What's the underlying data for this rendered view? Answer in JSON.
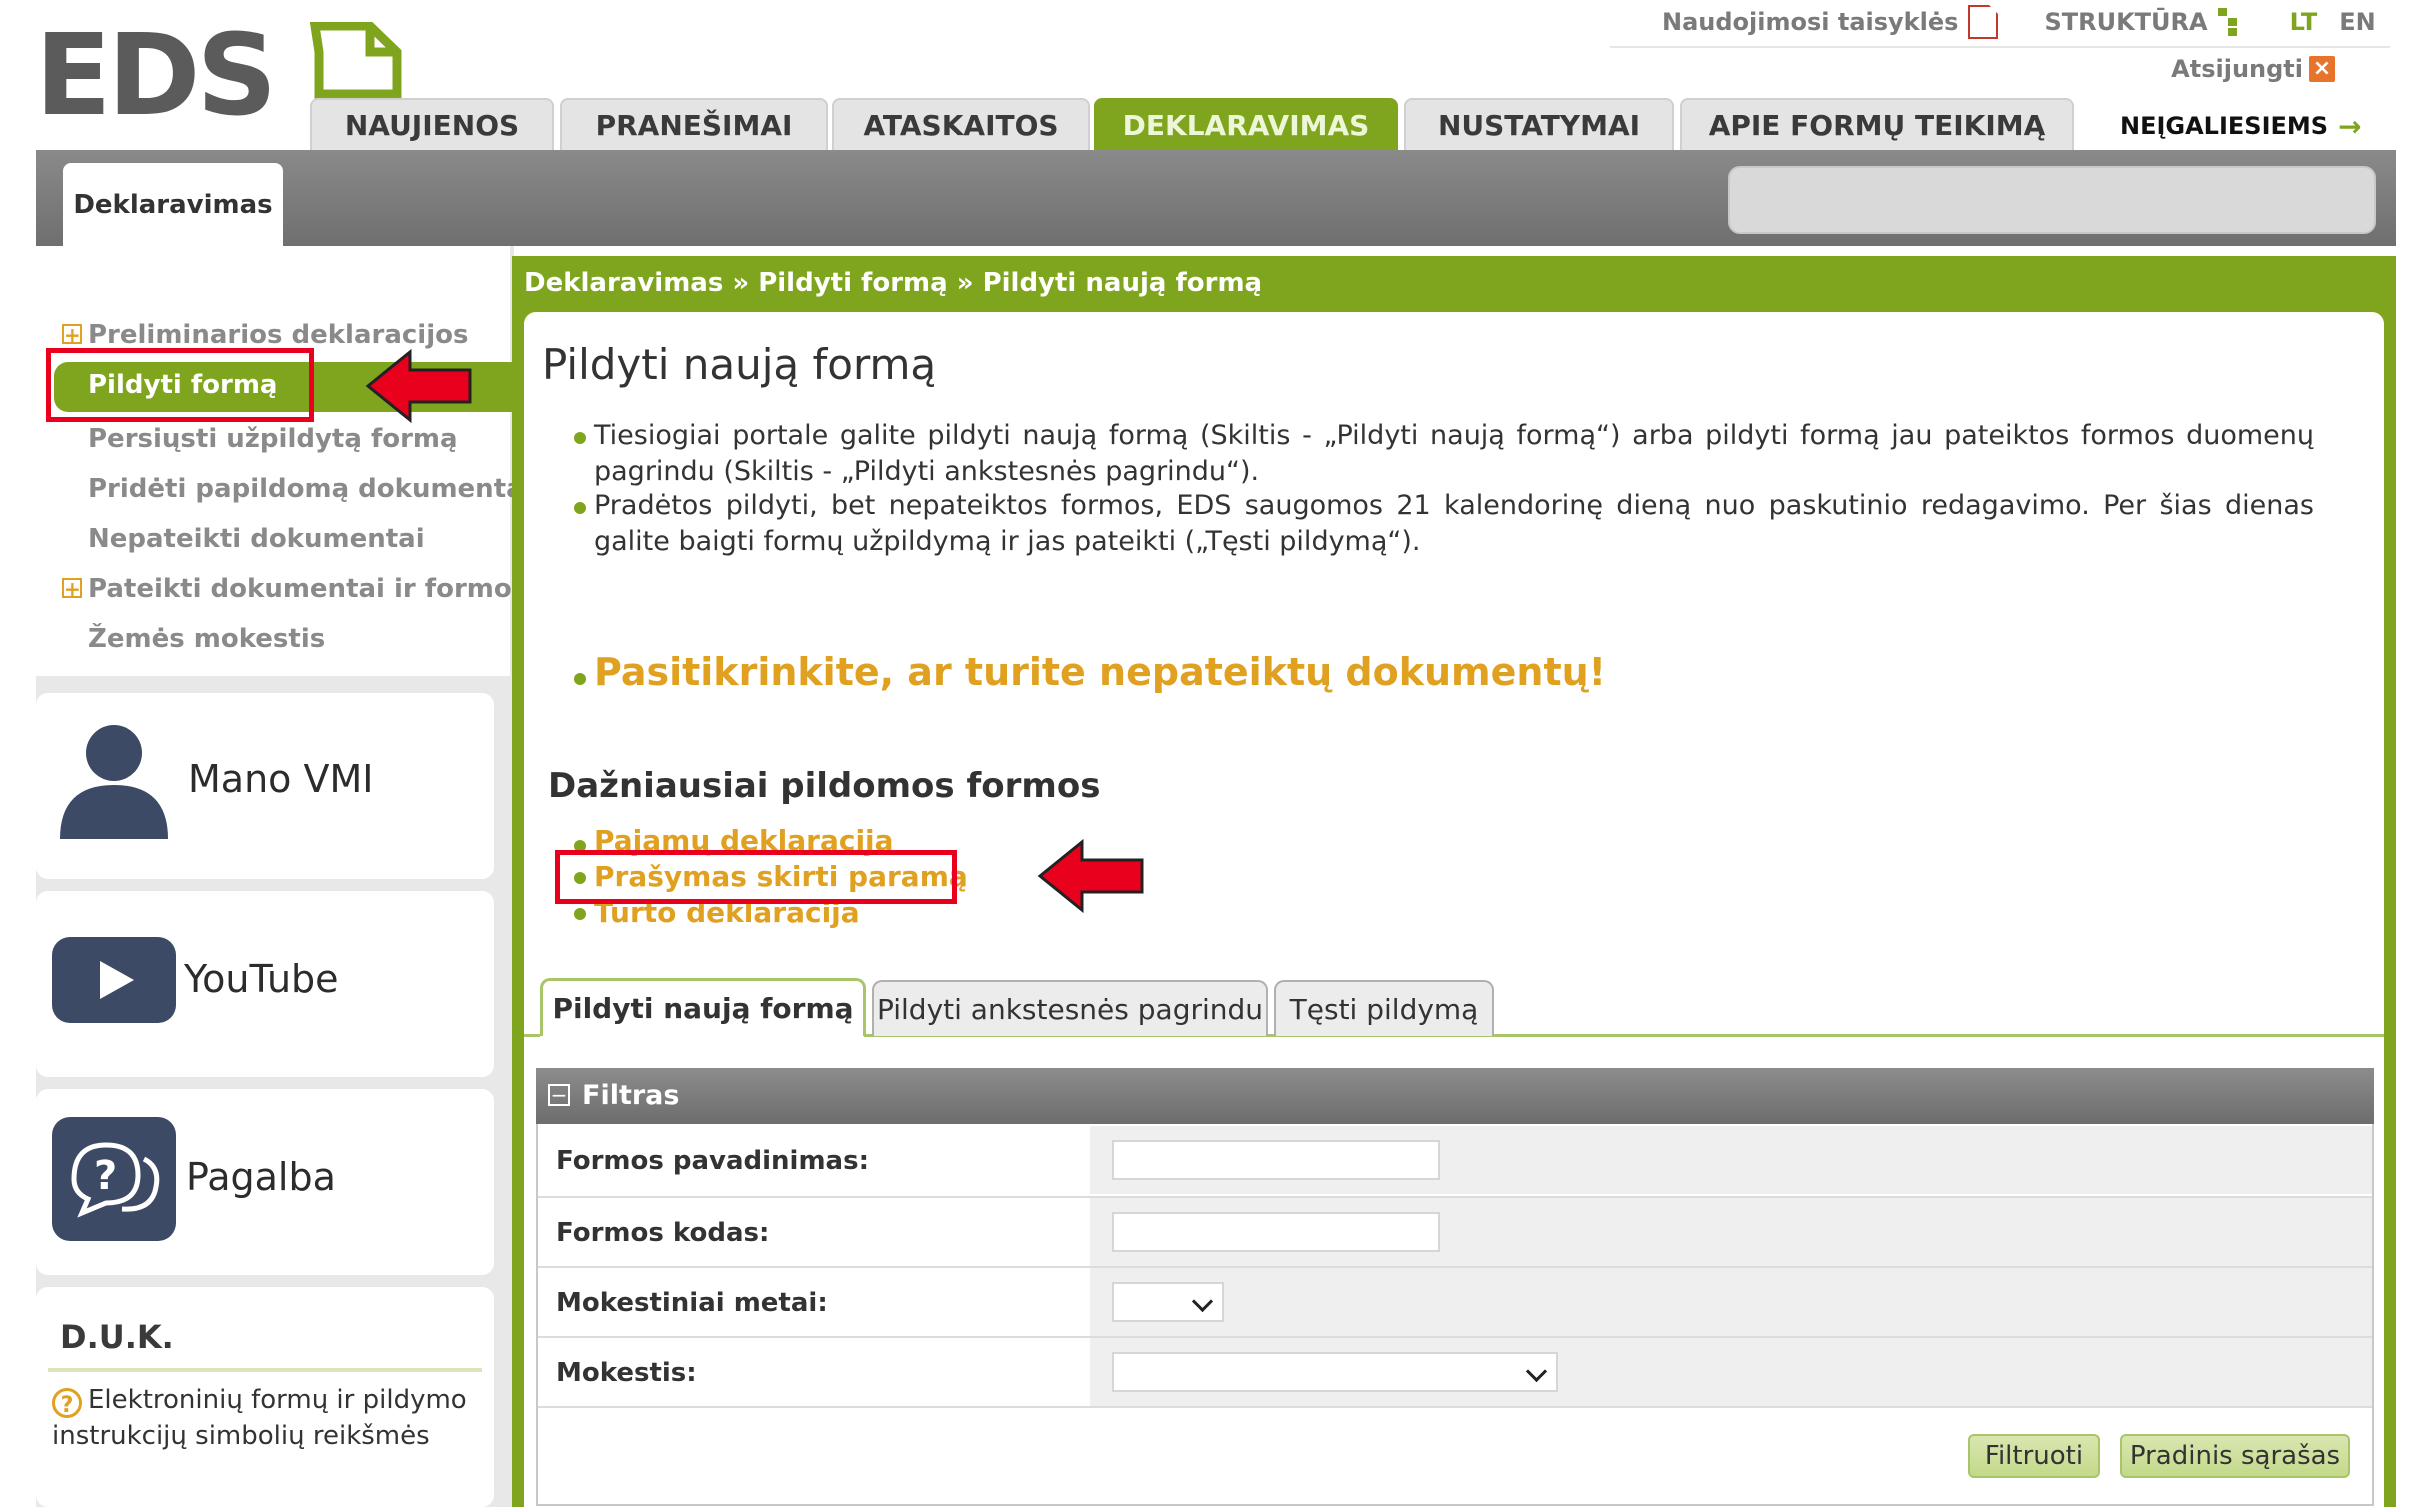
{
  "header": {
    "logo_text": "EDS",
    "top_links": {
      "rules": "Naudojimosi taisyklės",
      "structure": "STRUKTŪRA",
      "lang_lt": "LT",
      "lang_en": "EN",
      "logout": "Atsijungti"
    },
    "nav_tabs": [
      "NAUJIENOS",
      "PRANEŠIMAI",
      "ATASKAITOS",
      "DEKLARAVIMAS",
      "NUSTATYMAI",
      "APIE FORMŲ TEIKIMĄ"
    ],
    "active_tab": "DEKLARAVIMAS",
    "accessibility": "NEĮGALIESIEMS",
    "sub_tab": "Deklaravimas"
  },
  "sidebar": {
    "menu": [
      {
        "label": "Preliminarios deklaracijos",
        "expandable": true
      },
      {
        "label": "Pildyti formą",
        "active": true
      },
      {
        "label": "Persiųsti užpildytą formą"
      },
      {
        "label": "Pridėti papildomą dokumentą"
      },
      {
        "label": "Nepateikti dokumentai"
      },
      {
        "label": "Pateikti dokumentai ir formos",
        "expandable": true
      },
      {
        "label": "Žemės mokestis"
      }
    ],
    "cards": [
      {
        "label": "Mano VMI",
        "icon": "user-icon"
      },
      {
        "label": "YouTube",
        "icon": "youtube-play-icon"
      },
      {
        "label": "Pagalba",
        "icon": "help-chat-icon"
      }
    ],
    "faq": {
      "title": "D.U.K.",
      "link": "Elektroninių formų ir pildymo instrukcijų simbolių reikšmės"
    }
  },
  "main": {
    "breadcrumb": "Deklaravimas » Pildyti formą » Pildyti naują formą",
    "title": "Pildyti naują formą",
    "info": [
      "Tiesiogiai portale galite pildyti naują formą (Skiltis - „Pildyti naują formą“) arba pildyti formą jau pateiktos formos duomenų pagrindu (Skiltis - „Pildyti ankstesnės pagrindu“).",
      "Pradėtos pildyti, bet nepateiktos formos, EDS saugomos 21 kalendorinę dieną nuo paskutinio redagavimo. Per šias dienas galite baigti formų užpildymą ir jas pateikti („Tęsti pildymą“)."
    ],
    "warning": "Pasitikrinkite, ar turite nepateiktų dokumentų!",
    "frequent_title": "Dažniausiai pildomos formos",
    "frequent_forms": [
      "Pajamų deklaracija",
      "Prašymas skirti paramą",
      "Turto deklaracija"
    ],
    "tabs": [
      "Pildyti naują formą",
      "Pildyti ankstesnės pagrindu",
      "Tęsti pildymą"
    ],
    "filter": {
      "title": "Filtras",
      "fields": {
        "form_name": {
          "label": "Formos pavadinimas:",
          "value": ""
        },
        "form_code": {
          "label": "Formos kodas:",
          "value": ""
        },
        "tax_year": {
          "label": "Mokestiniai metai:",
          "value": ""
        },
        "tax": {
          "label": "Mokestis:",
          "value": ""
        }
      },
      "buttons": {
        "filter": "Filtruoti",
        "reset": "Pradinis sąrašas"
      }
    }
  },
  "colors": {
    "accent_green": "#7fa51e",
    "highlight_orange": "#e0a020",
    "annotation_red": "#e8001c"
  }
}
